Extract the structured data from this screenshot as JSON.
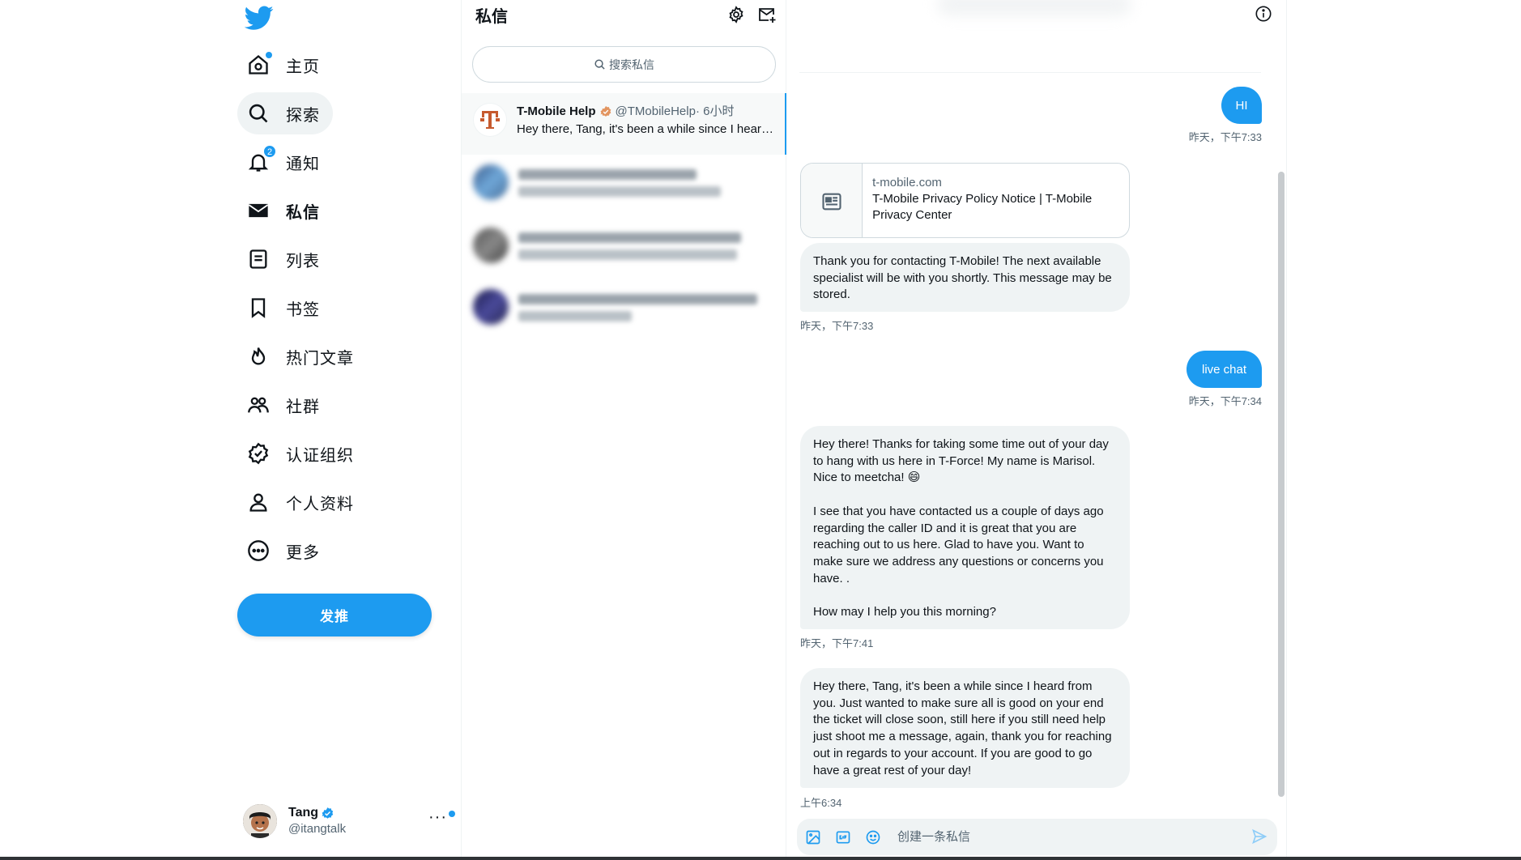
{
  "colors": {
    "accent": "#1d9bf0",
    "bubble_in": "#eff3f4",
    "muted": "#536471"
  },
  "nav": {
    "items": [
      {
        "label": "主页",
        "icon": "home-icon"
      },
      {
        "label": "探索",
        "icon": "search-icon"
      },
      {
        "label": "通知",
        "icon": "bell-icon",
        "badge": "2"
      },
      {
        "label": "私信",
        "icon": "mail-icon"
      },
      {
        "label": "列表",
        "icon": "list-icon"
      },
      {
        "label": "书签",
        "icon": "bookmark-icon"
      },
      {
        "label": "热门文章",
        "icon": "flame-icon"
      },
      {
        "label": "社群",
        "icon": "communities-icon"
      },
      {
        "label": "认证组织",
        "icon": "verified-org-icon"
      },
      {
        "label": "个人资料",
        "icon": "person-icon"
      },
      {
        "label": "更多",
        "icon": "more-circle-icon"
      }
    ],
    "tweet_button": "发推"
  },
  "account": {
    "name": "Tang",
    "handle": "@itangtalk",
    "more": "···"
  },
  "messages_list": {
    "title": "私信",
    "search_placeholder": "搜索私信",
    "active_conversation": {
      "name": "T-Mobile Help",
      "handle": "@TMobileHelp",
      "time": "· 6小时",
      "preview": "Hey there, Tang, it's been a while since I heard from you..."
    }
  },
  "chat": {
    "messages": [
      {
        "from": "me",
        "text": "HI",
        "time": "昨天，下午7:33"
      },
      {
        "from": "them",
        "link_domain": "t-mobile.com",
        "link_title": "T-Mobile Privacy Policy Notice | T-Mobile Privacy Center"
      },
      {
        "from": "them",
        "text": "Thank you for contacting T-Mobile! The next available specialist will be with you shortly. This message may be stored.",
        "time": "昨天，下午7:33"
      },
      {
        "from": "me",
        "text": "live chat",
        "time": "昨天，下午7:34"
      },
      {
        "from": "them",
        "text": "Hey there! Thanks for taking some time out of your day to hang with us here in T-Force! My name is Marisol. Nice to meetcha! 😄\n\nI see that you have contacted us a couple of days ago regarding the caller ID and it is great that you are reaching out to us here. Glad to have you. Want to make sure we address any questions or concerns you have. .\n\nHow may I help you this morning?",
        "time": "昨天，下午7:41"
      },
      {
        "from": "them",
        "text": "Hey there, Tang, it's been a while since I heard from you. Just wanted to make sure all is good on your end the ticket will close soon, still here if you still need help just shoot me a message, again, thank you for reaching out in regards to your account. If you are good to go have a great rest of your day!",
        "time": "上午6:34"
      }
    ],
    "composer_placeholder": "创建一条私信"
  }
}
